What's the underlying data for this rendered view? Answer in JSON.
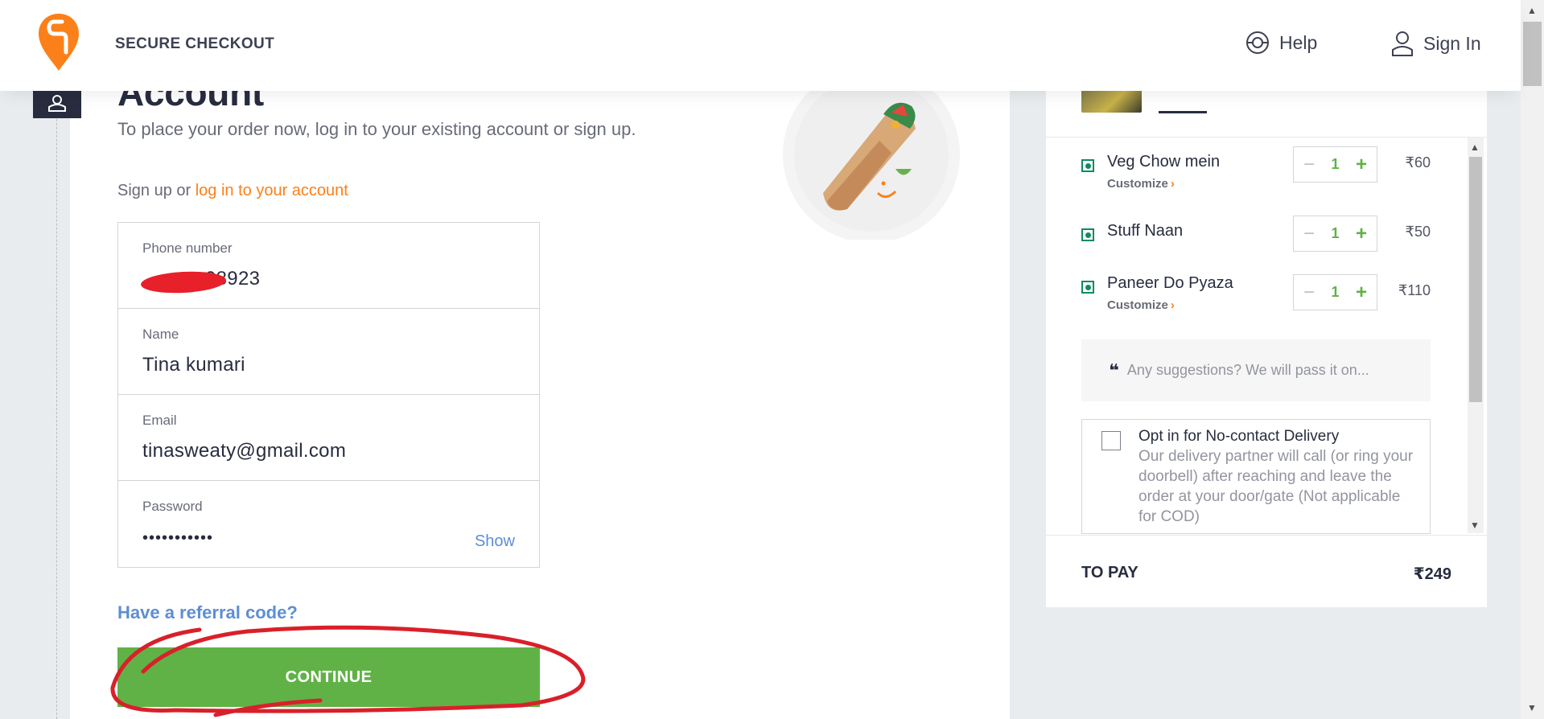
{
  "header": {
    "title": "SECURE CHECKOUT",
    "help_label": "Help",
    "signin_label": "Sign In",
    "brand_color": "#fc8019"
  },
  "account": {
    "title": "Account",
    "subtitle": "To place your order now, log in to your existing account or sign up.",
    "signup_prefix": "Sign up or ",
    "login_link": "log in to your account"
  },
  "form": {
    "phone_label": "Phone number",
    "phone_value": "08923",
    "name_label": "Name",
    "name_value": "Tina kumari",
    "email_label": "Email",
    "email_value": "tinasweaty@gmail.com",
    "password_label": "Password",
    "password_value": "•••••••••••",
    "show_label": "Show"
  },
  "referral_label": "Have a referral code?",
  "continue_label": "CONTINUE",
  "cart": {
    "items": [
      {
        "name": "Veg Chow mein",
        "customize": "Customize",
        "qty": "1",
        "price": "₹60"
      },
      {
        "name": "Stuff Naan",
        "customize": "",
        "qty": "1",
        "price": "₹50"
      },
      {
        "name": "Paneer Do Pyaza",
        "customize": "Customize",
        "qty": "1",
        "price": "₹110"
      }
    ],
    "suggestion_placeholder": "Any suggestions? We will pass it on...",
    "no_contact_title": "Opt in for No-contact Delivery",
    "no_contact_body": "Our delivery partner will call (or ring your doorbell) after reaching and leave the order at your door/gate (Not applicable for COD)",
    "to_pay_label": "TO PAY",
    "to_pay_amount": "₹249",
    "accent_green": "#60b246"
  }
}
